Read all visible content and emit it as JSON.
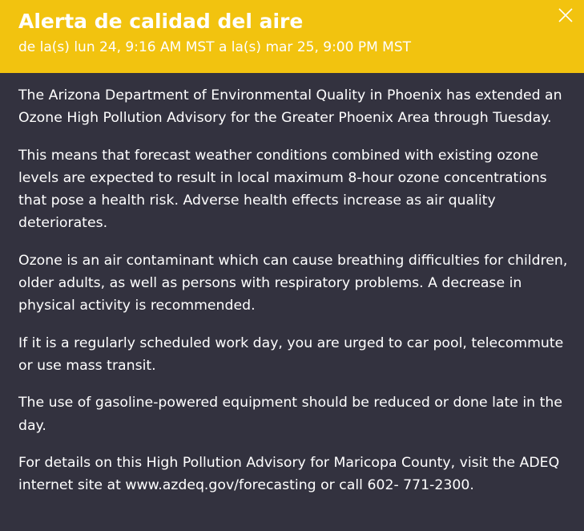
{
  "alert": {
    "title": "Alerta de calidad del aire",
    "period": "de la(s) lun 24, 9:16 AM MST a la(s) mar 25, 9:00 PM MST",
    "close_icon": "close-icon",
    "colors": {
      "header_bg": "#f2c30f",
      "body_bg": "#33323f",
      "text": "#ffffff"
    },
    "paragraphs": [
      "The Arizona Department of Environmental Quality in Phoenix has extended an Ozone High Pollution Advisory for the Greater Phoenix Area through Tuesday.",
      "This means that forecast weather conditions combined with existing ozone levels are expected to result in local maximum 8-hour ozone concentrations that pose a health risk. Adverse health effects increase as air quality deteriorates.",
      "Ozone is an air contaminant which can cause breathing difficulties for children, older adults, as well as persons with respiratory problems. A decrease in physical activity is recommended.",
      "If it is a regularly scheduled work day, you are urged to car pool, telecommute or use mass transit.",
      "The use of gasoline-powered equipment should be reduced or done late in the day.",
      "For details on this High Pollution Advisory for Maricopa County, visit the ADEQ internet site at www.azdeq.gov/forecasting or call 602- 771-2300."
    ]
  }
}
